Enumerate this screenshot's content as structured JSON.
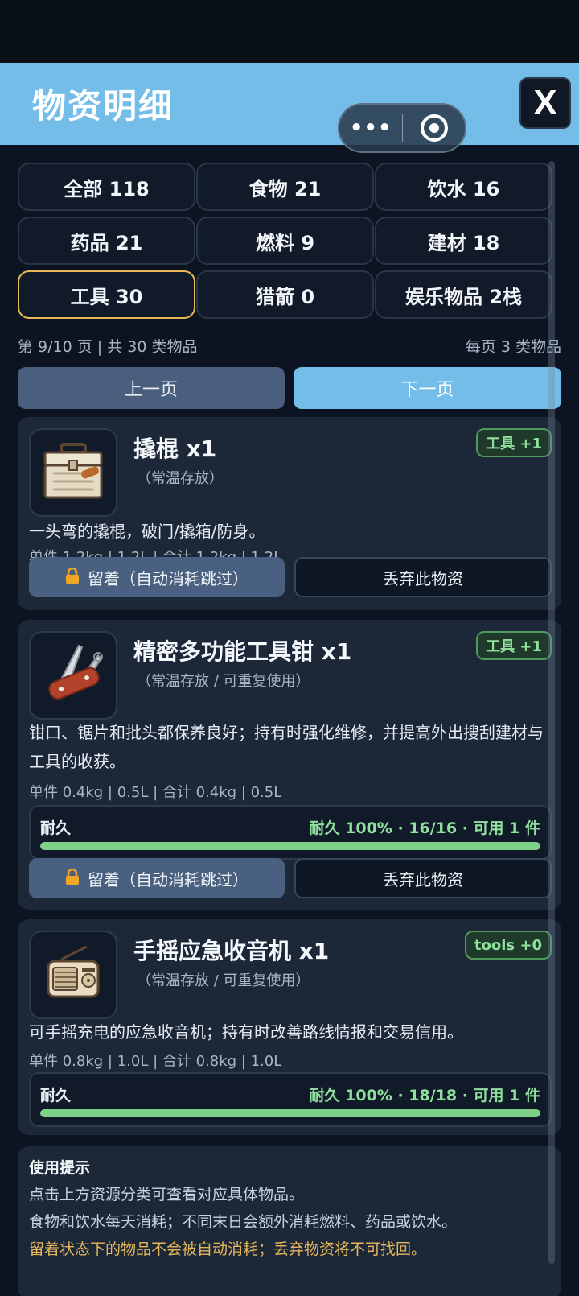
{
  "header": {
    "title": "物资明细",
    "close_label": "X",
    "capsule_more": "•••"
  },
  "categories": [
    {
      "label": "全部 118",
      "active": false
    },
    {
      "label": "食物 21",
      "active": false
    },
    {
      "label": "饮水 16",
      "active": false
    },
    {
      "label": "药品 21",
      "active": false
    },
    {
      "label": "燃料 9",
      "active": false
    },
    {
      "label": "建材 18",
      "active": false
    },
    {
      "label": "工具 30",
      "active": true
    },
    {
      "label": "猎箭 0",
      "active": false
    },
    {
      "label": "娱乐物品 2栈",
      "active": false
    }
  ],
  "pagination": {
    "info": "第 9/10 页 | 共 30 类物品",
    "per_page": "每页 3 类物品",
    "prev_label": "上一页",
    "next_label": "下一页"
  },
  "items": [
    {
      "name": "撬棍 x1",
      "storage": "（常温存放）",
      "tag": "工具 +1",
      "icon": "toolbox-icon",
      "description": "一头弯的撬棍，破门/撬箱/防身。",
      "spec": "单件 1.2kg | 1.2L | 合计 1.2kg | 1.2L",
      "keep_label": "留着（自动消耗跳过）",
      "discard_label": "丢弃此物资"
    },
    {
      "name": "精密多功能工具钳 x1",
      "storage": "（常温存放 / 可重复使用）",
      "tag": "工具 +1",
      "icon": "multitool-icon",
      "description": "钳口、锯片和批头都保养良好；持有时强化维修，并提高外出搜刮建材与工具的收获。",
      "spec": "单件 0.4kg | 0.5L | 合计 0.4kg | 0.5L",
      "durability_label": "耐久",
      "durability_value": "耐久 100% · 16/16 · 可用 1 件",
      "durability_fraction": 1.0,
      "keep_label": "留着（自动消耗跳过）",
      "discard_label": "丢弃此物资"
    },
    {
      "name": "手摇应急收音机 x1",
      "storage": "（常温存放 / 可重复使用）",
      "tag": "tools +0",
      "icon": "radio-icon",
      "description": "可手摇充电的应急收音机；持有时改善路线情报和交易信用。",
      "spec": "单件 0.8kg | 1.0L | 合计 0.8kg | 1.0L",
      "durability_label": "耐久",
      "durability_value": "耐久 100% · 18/18 · 可用 1 件",
      "durability_fraction": 1.0
    }
  ],
  "tips": {
    "title": "使用提示",
    "lines": [
      "点击上方资源分类可查看对应具体物品。",
      "食物和饮水每天消耗；不同末日会额外消耗燃料、药品或饮水。",
      "留着状态下的物品不会被自动消耗；丢弃物资将不可找回。"
    ]
  },
  "colors": {
    "header_bg": "#74bde8",
    "active_border": "#e6b85a",
    "tag_green": "#8fe09d",
    "durability_fill": "#7fd18a"
  }
}
